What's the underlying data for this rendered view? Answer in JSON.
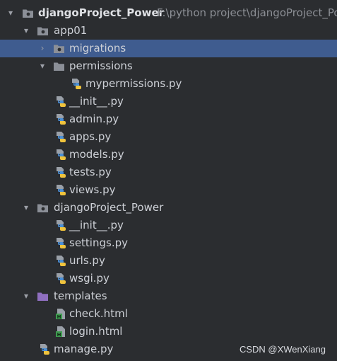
{
  "tree": {
    "root": {
      "name": "djangoProject_Power",
      "path": "F:\\python project\\djangoProject_Po"
    },
    "app01": {
      "name": "app01",
      "migrations": "migrations",
      "permissions": "permissions",
      "permissions_files": [
        "mypermissions.py"
      ],
      "files": [
        "__init__.py",
        "admin.py",
        "apps.py",
        "models.py",
        "tests.py",
        "views.py"
      ]
    },
    "project_pkg": {
      "name": "djangoProject_Power",
      "files": [
        "__init__.py",
        "settings.py",
        "urls.py",
        "wsgi.py"
      ]
    },
    "templates": {
      "name": "templates",
      "files": [
        "check.html",
        "login.html"
      ]
    },
    "manage": "manage.py"
  },
  "watermark": "CSDN @XWenXiang",
  "colors": {
    "background": "#2b2d30",
    "selection": "#3f5c8f",
    "text": "#cdd0d6",
    "folder": "#8b8f97",
    "templates_folder": "#8f6fbf",
    "python_blue": "#4a8fd6",
    "python_yellow": "#f0c33c",
    "html_green": "#3f9b50"
  }
}
